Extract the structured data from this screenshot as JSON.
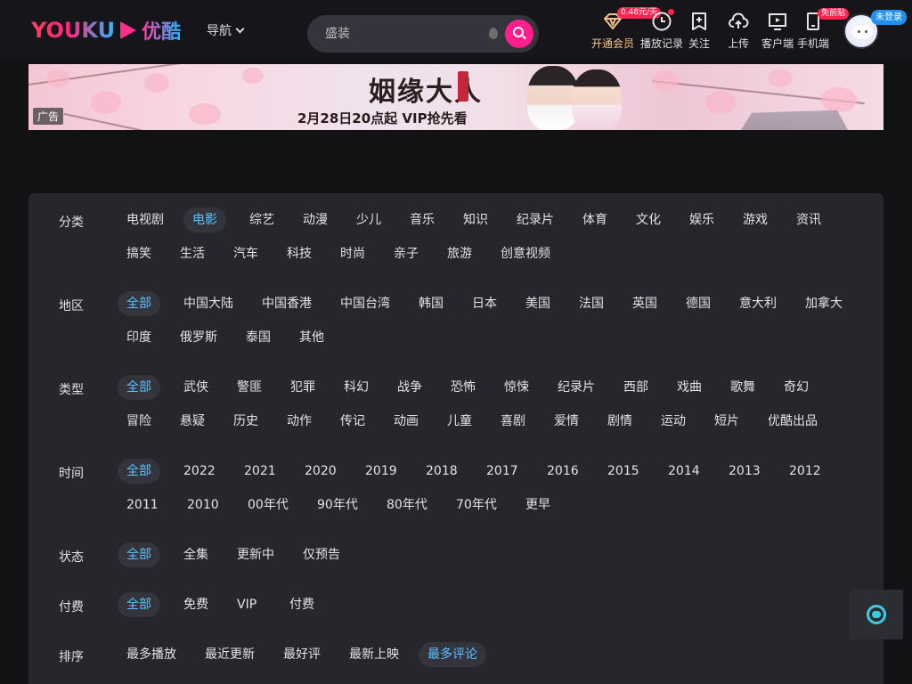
{
  "header": {
    "logo_text": "YOUKU",
    "logo_cn": "优酷",
    "nav_label": "导航",
    "search_placeholder": "盛装",
    "items": [
      {
        "label": "开通会员",
        "badge": "0.48元/天",
        "icon": "diamond-icon"
      },
      {
        "label": "播放记录",
        "badge": "",
        "icon": "clock-icon"
      },
      {
        "label": "关注",
        "badge": "",
        "icon": "bookmark-plus-icon"
      },
      {
        "label": "上传",
        "badge": "",
        "icon": "cloud-upload-icon"
      },
      {
        "label": "客户端",
        "badge": "",
        "icon": "monitor-play-icon"
      },
      {
        "label": "手机端",
        "badge": "免前贴",
        "icon": "phone-icon"
      }
    ],
    "login_badge": "未登录"
  },
  "banner": {
    "ad_label": "广告",
    "title": "姻缘大人",
    "subtitle": "2月28日20点起  VIP抢先看"
  },
  "filters": [
    {
      "label": "分类",
      "options": [
        "电视剧",
        "电影",
        "综艺",
        "动漫",
        "少儿",
        "音乐",
        "知识",
        "纪录片",
        "体育",
        "文化",
        "娱乐",
        "游戏",
        "资讯",
        "搞笑",
        "生活",
        "汽车",
        "科技",
        "时尚",
        "亲子",
        "旅游",
        "创意视频"
      ],
      "selected": "电影"
    },
    {
      "label": "地区",
      "options": [
        "全部",
        "中国大陆",
        "中国香港",
        "中国台湾",
        "韩国",
        "日本",
        "美国",
        "法国",
        "英国",
        "德国",
        "意大利",
        "加拿大",
        "印度",
        "俄罗斯",
        "泰国",
        "其他"
      ],
      "selected": "全部"
    },
    {
      "label": "类型",
      "options": [
        "全部",
        "武侠",
        "警匪",
        "犯罪",
        "科幻",
        "战争",
        "恐怖",
        "惊悚",
        "纪录片",
        "西部",
        "戏曲",
        "歌舞",
        "奇幻",
        "冒险",
        "悬疑",
        "历史",
        "动作",
        "传记",
        "动画",
        "儿童",
        "喜剧",
        "爱情",
        "剧情",
        "运动",
        "短片",
        "优酷出品"
      ],
      "selected": "全部"
    },
    {
      "label": "时间",
      "options": [
        "全部",
        "2022",
        "2021",
        "2020",
        "2019",
        "2018",
        "2017",
        "2016",
        "2015",
        "2014",
        "2013",
        "2012",
        "2011",
        "2010",
        "00年代",
        "90年代",
        "80年代",
        "70年代",
        "更早"
      ],
      "selected": "全部"
    },
    {
      "label": "状态",
      "options": [
        "全部",
        "全集",
        "更新中",
        "仅预告"
      ],
      "selected": "全部"
    },
    {
      "label": "付费",
      "options": [
        "全部",
        "免费",
        "VIP",
        "付费"
      ],
      "selected": "全部"
    },
    {
      "label": "排序",
      "options": [
        "最多播放",
        "最近更新",
        "最好评",
        "最新上映",
        "最多评论"
      ],
      "selected": "最多评论"
    }
  ],
  "colors": {
    "accent_blue": "#5cc3ff",
    "brand_pink": "#ff1e8c",
    "vip_gold": "#f3c38b",
    "badge_red": "#ff2452"
  },
  "float_button_icon": "customer-service-icon"
}
